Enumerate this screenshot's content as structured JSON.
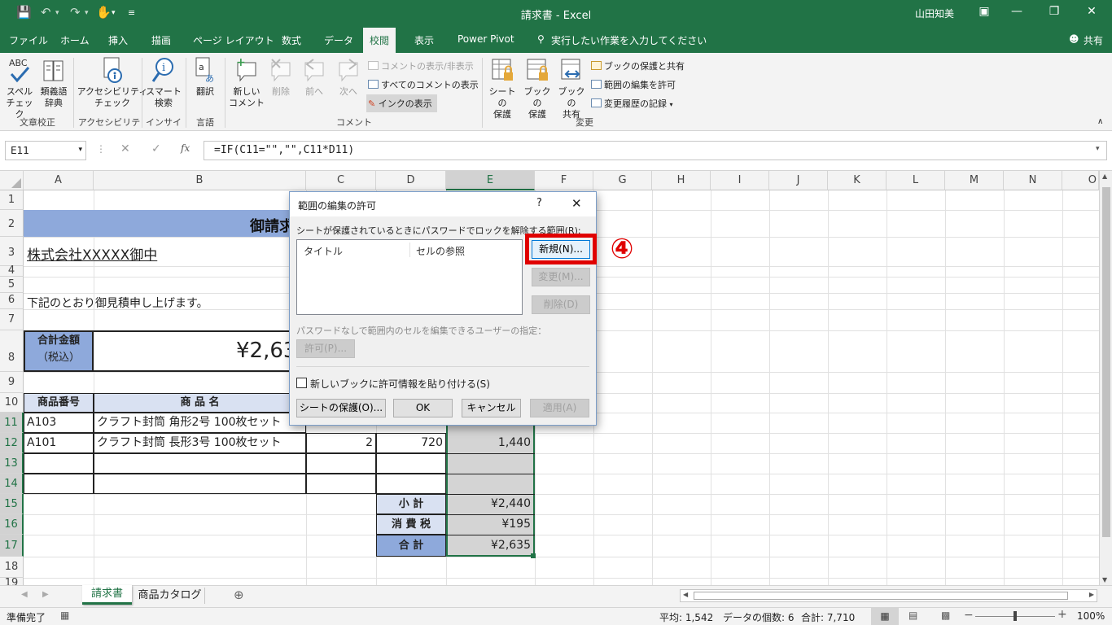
{
  "window": {
    "title": "請求書 - Excel",
    "user": "山田知美"
  },
  "tabs": [
    "ファイル",
    "ホーム",
    "挿入",
    "描画",
    "ページ レイアウト",
    "数式",
    "データ",
    "校閲",
    "表示",
    "Power Pivot"
  ],
  "tell_me": "実行したい作業を入力してください",
  "share": "共有",
  "ribbon": {
    "spell": "スペル\nチェック",
    "thesaurus": "類義語\n辞典",
    "group_proofing": "文章校正",
    "accessibility": "アクセシビリティ\nチェック",
    "group_accessibility": "アクセシビリティ",
    "smart": "スマート\n検索",
    "group_insight": "インサイト",
    "translate": "翻訳",
    "group_language": "言語",
    "new_comment": "新しい\nコメント",
    "delete": "削除",
    "prev": "前へ",
    "next": "次へ",
    "show_hide_comment": "コメントの表示/非表示",
    "show_all_comments": "すべてのコメントの表示",
    "show_ink": "インクの表示",
    "group_comment": "コメント",
    "protect_sheet": "シートの\n保護",
    "protect_book": "ブックの\n保護",
    "share_book": "ブックの\n共有",
    "protect_share": "ブックの保護と共有",
    "allow_edit": "範囲の編集を許可",
    "track_changes": "変更履歴の記録",
    "group_changes": "変更"
  },
  "formula_bar": {
    "name_box": "E11",
    "formula": "=IF(C11=\"\",\"\",C11*D11)"
  },
  "columns": [
    "A",
    "B",
    "C",
    "D",
    "E",
    "F",
    "G",
    "H",
    "I",
    "J",
    "K",
    "L",
    "M",
    "N",
    "O"
  ],
  "rows": [
    "1",
    "2",
    "3",
    "4",
    "5",
    "6",
    "7",
    "8",
    "9",
    "10",
    "11",
    "12",
    "13",
    "14",
    "15",
    "16",
    "17",
    "18",
    "19"
  ],
  "sheet": {
    "title_partial": "御請求",
    "company": "株式会社XXXXX御中",
    "intro": "下記のとおり御見積申し上げます。",
    "total_label_1": "合計金額",
    "total_label_2": "（税込）",
    "total_value_partial": "¥2,63",
    "hdr_code": "商品番号",
    "hdr_name": "商 品 名",
    "r11_code": "A103",
    "r11_name": "クラフト封筒 角形2号 100枚セット",
    "r12_code": "A101",
    "r12_name": "クラフト封筒 長形3号 100枚セット",
    "r12_qty": "2",
    "r12_price": "720",
    "r12_amount": "1,440",
    "subtotal_label": "小 計",
    "subtotal": "¥2,440",
    "tax_label": "消 費 税",
    "tax": "¥195",
    "grand_label": "合 計",
    "grand": "¥2,635"
  },
  "sheet_tabs": [
    "請求書",
    "商品カタログ"
  ],
  "status": {
    "ready": "準備完了",
    "average": "平均: 1,542",
    "count": "データの個数: 6",
    "sum": "合計: 7,710",
    "zoom": "100%"
  },
  "dialog": {
    "title": "範囲の編集の許可",
    "help": "?",
    "label_ranges": "シートが保護されているときにパスワードでロックを解除する範囲(R):",
    "col_title": "タイトル",
    "col_ref": "セルの参照",
    "btn_new": "新規(N)...",
    "btn_modify": "変更(M)...",
    "btn_delete": "削除(D)",
    "label_users": "パスワードなしで範囲内のセルを編集できるユーザーの指定：",
    "btn_permissions": "許可(P)...",
    "checkbox_paste": "新しいブックに許可情報を貼り付ける(S)",
    "btn_protect": "シートの保護(O)...",
    "btn_ok": "OK",
    "btn_cancel": "キャンセル",
    "btn_apply": "適用(A)"
  },
  "annotation": "④",
  "colors": {
    "excel_green": "#217346",
    "highlight_red": "#e00000",
    "header_blue": "#8ea9db",
    "header_light": "#d9e1f2"
  }
}
